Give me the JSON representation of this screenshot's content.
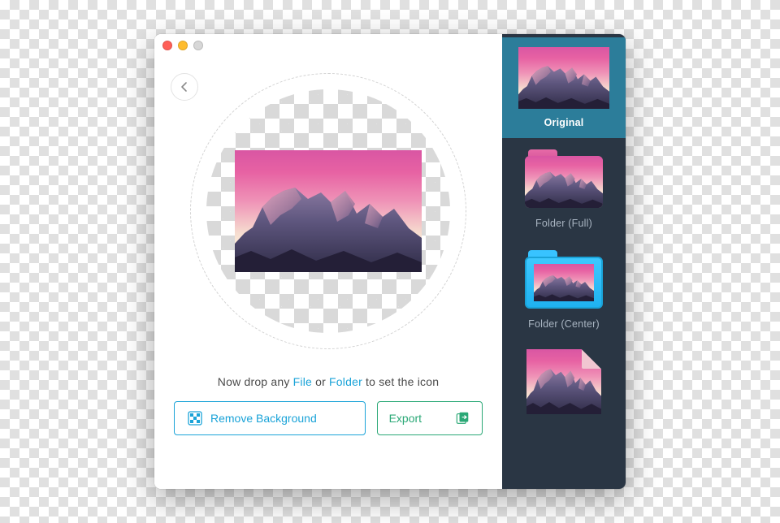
{
  "window": {
    "traffic_lights": {
      "close": "#ff5f57",
      "min": "#febc2e",
      "disabled": "#d7d7d7"
    }
  },
  "toolbar": {
    "back_name": "back",
    "settings_name": "settings"
  },
  "hint": {
    "prefix": "Now drop any ",
    "file_link": "File",
    "middle": " or ",
    "folder_link": "Folder",
    "suffix": " to set the icon"
  },
  "actions": {
    "remove_label": "Remove Background",
    "export_label": "Export"
  },
  "sidebar": {
    "presets": [
      {
        "id": "original",
        "label": "Original",
        "selected": true,
        "kind": "original"
      },
      {
        "id": "folder-full",
        "label": "Folder (Full)",
        "selected": false,
        "kind": "folder-full"
      },
      {
        "id": "folder-center",
        "label": "Folder (Center)",
        "selected": false,
        "kind": "folder-center"
      },
      {
        "id": "document",
        "label": "",
        "selected": false,
        "kind": "document"
      }
    ]
  },
  "colors": {
    "accent_blue": "#1aa3d8",
    "accent_green": "#2aa876",
    "sidebar_bg": "#2A3644",
    "selected_bg": "#2C7D9A"
  }
}
